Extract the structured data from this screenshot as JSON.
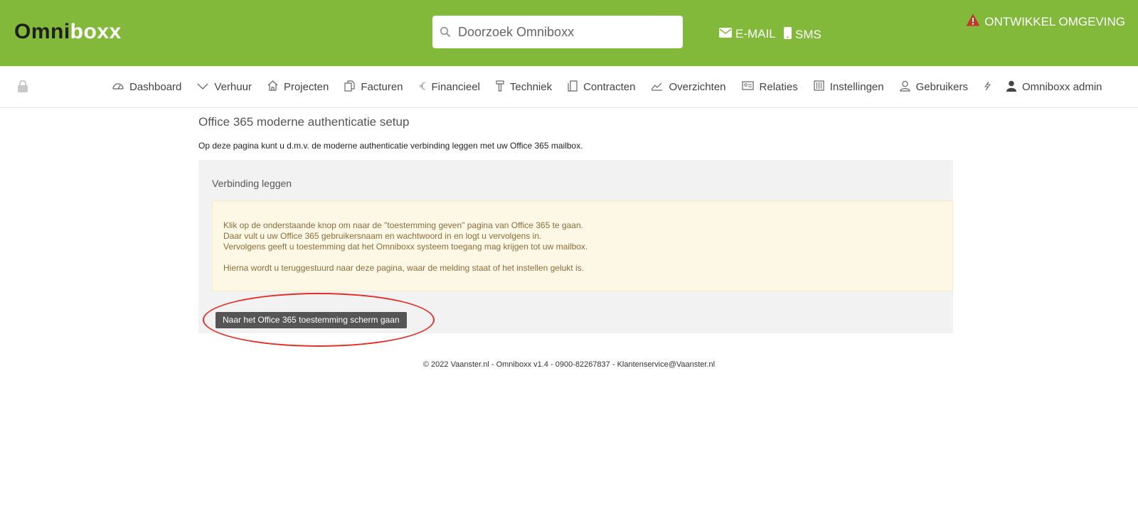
{
  "header": {
    "logo_part1": "Omni",
    "logo_part2": "boxx",
    "search_placeholder": "Doorzoek Omniboxx",
    "email_label": "E-MAIL",
    "sms_label": "SMS",
    "environment_label": "ONTWIKKEL OMGEVING",
    "colors": {
      "header_bg": "#82b93a",
      "warning": "#c0392b"
    }
  },
  "nav": {
    "items": [
      {
        "label": "Dashboard",
        "icon": "dashboard-icon"
      },
      {
        "label": "Verhuur",
        "icon": "chevron-down-icon"
      },
      {
        "label": "Projecten",
        "icon": "home-icon"
      },
      {
        "label": "Facturen",
        "icon": "documents-icon"
      },
      {
        "label": "Financieel",
        "icon": "euro-icon"
      },
      {
        "label": "Techniek",
        "icon": "hammer-icon"
      },
      {
        "label": "Contracten",
        "icon": "contract-icon"
      },
      {
        "label": "Overzichten",
        "icon": "chart-line-icon"
      },
      {
        "label": "Relaties",
        "icon": "id-card-icon"
      },
      {
        "label": "Instellingen",
        "icon": "sliders-icon"
      },
      {
        "label": "Gebruikers",
        "icon": "user-icon"
      },
      {
        "label": "",
        "icon": "lightning-icon"
      },
      {
        "label": "Omniboxx admin",
        "icon": "user-filled-icon"
      }
    ]
  },
  "main": {
    "title": "Office 365 moderne authenticatie setup",
    "intro": "Op deze pagina kunt u d.m.v. de moderne authenticatie verbinding leggen met uw Office 365 mailbox.",
    "panel_title": "Verbinding leggen",
    "alert_lines": [
      "Klik op de onderstaande knop om naar de \"toestemming geven\" pagina van Office 365 te gaan.",
      "Daar vult u uw Office 365 gebruikersnaam en wachtwoord in en logt u vervolgens in.",
      "Vervolgens geeft u toestemming dat het Omniboxx systeem toegang mag krijgen tot uw mailbox.",
      "Hierna wordt u teruggestuurd naar deze pagina, waar de melding staat of het instellen gelukt is."
    ],
    "button_label": "Naar het Office 365 toestemming scherm gaan"
  },
  "footer": {
    "text": "© 2022 Vaanster.nl - Omniboxx v1.4 - 0900-82267837 - Klantenservice@Vaanster.nl"
  }
}
